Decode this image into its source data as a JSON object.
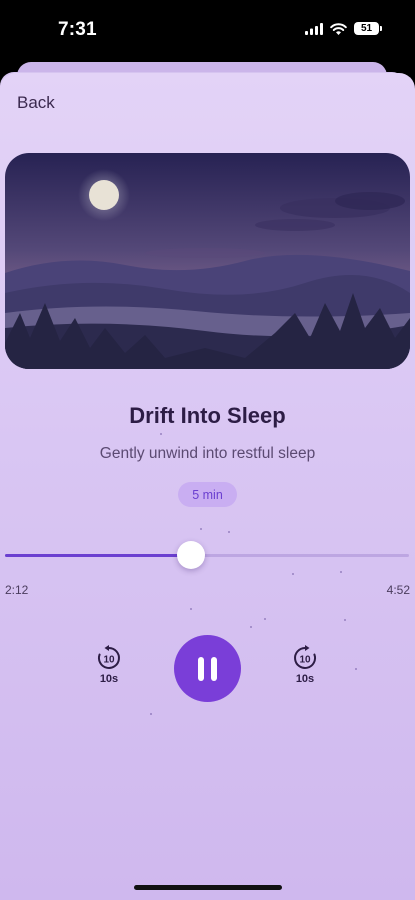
{
  "status_bar": {
    "time": "7:31",
    "battery": "51"
  },
  "nav": {
    "back_label": "Back"
  },
  "session": {
    "title": "Drift Into Sleep",
    "subtitle": "Gently unwind into restful sleep",
    "duration": "5 min"
  },
  "player": {
    "elapsed": "2:12",
    "total": "4:52",
    "progress": 0.46,
    "rewind_label": "10s",
    "forward_label": "10s",
    "skip_icon_number": "10"
  },
  "colors": {
    "accent": "#7a3ed8",
    "badge_bg": "#c9aef2",
    "title": "#2d1d45"
  },
  "icons": {
    "signal": "cellular-signal-icon",
    "wifi": "wifi-icon",
    "battery": "battery-icon",
    "rewind": "rewind-10-icon",
    "forward": "forward-10-icon",
    "pause": "pause-icon"
  }
}
